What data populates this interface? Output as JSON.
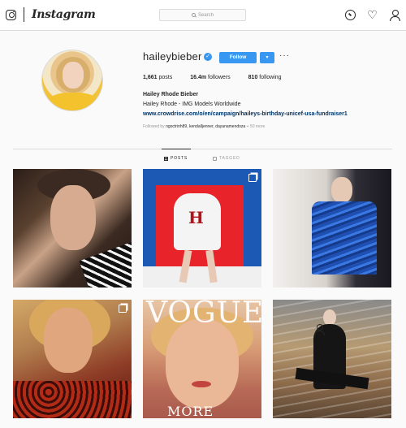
{
  "header": {
    "brand": "Instagram",
    "search_placeholder": "Search",
    "icons": [
      "instagram-glyph-icon",
      "explore-compass-icon",
      "activity-heart-icon",
      "profile-person-icon"
    ]
  },
  "profile": {
    "username": "haileybieber",
    "verified": true,
    "follow_label": "Follow",
    "dropdown_glyph": "▾",
    "more_glyph": "···",
    "stats": {
      "posts_count": "1,661",
      "posts_label": "posts",
      "followers_count": "16.4m",
      "followers_label": "followers",
      "following_count": "810",
      "following_label": "following"
    },
    "full_name": "Hailey Rhode Bieber",
    "bio": "Hailey Rhode - IMG Models Worldwide",
    "link": "www.crowdrise.com/o/en/campaign/haileys-birthday-unicef-usa-fundraiser1",
    "followed_by_prefix": "Followed by",
    "followed_by_names": "ngoctrinh89, kendalljenner, dayanamendoza",
    "followed_by_suffix": "+ 50 more"
  },
  "tabs": [
    {
      "label": "POSTS",
      "active": true
    },
    {
      "label": "TAGGED",
      "active": false
    }
  ],
  "posts": [
    {
      "alt": "post-1",
      "multi": false
    },
    {
      "alt": "post-2",
      "multi": true
    },
    {
      "alt": "post-3",
      "multi": false
    },
    {
      "alt": "post-4",
      "multi": true
    },
    {
      "alt": "post-5",
      "multi": false,
      "cover_title": "VOGUE",
      "cover_word": "MORE"
    },
    {
      "alt": "post-6",
      "multi": false
    }
  ],
  "colors": {
    "accent": "#3897f0",
    "link": "#003569",
    "border": "#dbdbdb",
    "muted": "#999999"
  }
}
